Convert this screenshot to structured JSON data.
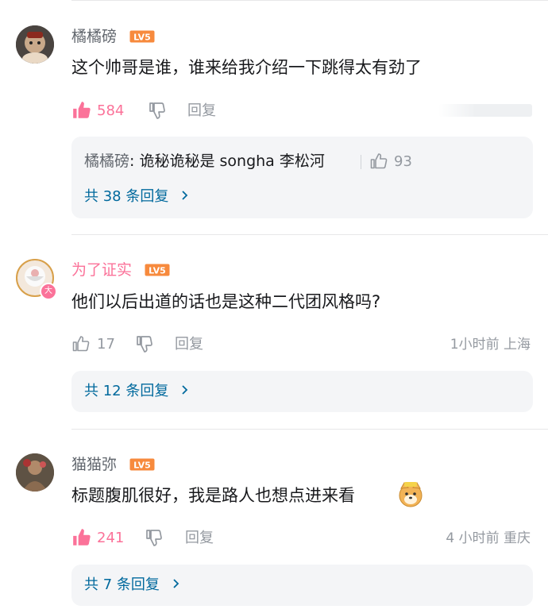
{
  "comments": [
    {
      "username": "橘橘磅",
      "level": "LV5",
      "content": "这个帅哥是谁，谁来给我介绍一下跳得太有劲了",
      "likes": "584",
      "liked": true,
      "reply_label": "回复",
      "time_location": "",
      "sub_reply": {
        "user": "橘橘磅",
        "text": "诡秘诡秘是 songha 李松河",
        "likes": "93"
      },
      "more_replies": "共 38 条回复"
    },
    {
      "username": "为了证实",
      "level": "LV5",
      "content": "他们以后出道的话也是这种二代团风格吗?",
      "likes": "17",
      "liked": false,
      "reply_label": "回复",
      "time_location": "1小时前 上海",
      "badge": "大",
      "more_replies": "共 12 条回复"
    },
    {
      "username": "猫猫弥",
      "level": "LV5",
      "content": "标题腹肌很好，我是路人也想点进来看",
      "likes": "241",
      "liked": true,
      "reply_label": "回复",
      "time_location": "4 小时前 重庆",
      "more_replies": "共 7 条回复"
    }
  ],
  "colors": {
    "pink": "#fb7299",
    "lv_orange": "#f78a3d",
    "link_blue": "#00699d"
  }
}
